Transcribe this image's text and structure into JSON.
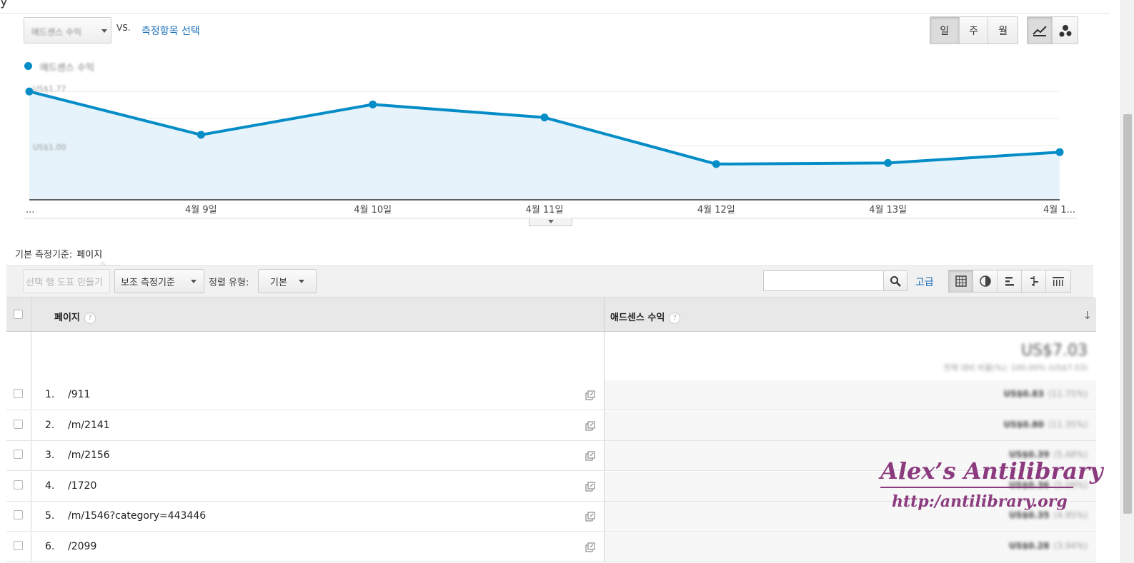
{
  "header": {
    "metric_select": "애드센스 수익",
    "vs": "VS.",
    "choose_metric": "측정항목 선택",
    "period_buttons": [
      "일",
      "주",
      "월"
    ],
    "active_period": "일"
  },
  "legend": {
    "label": "애드센스 수익",
    "color": "#058dc7"
  },
  "chart_data": {
    "type": "area",
    "x": [
      "...",
      "4월 9일",
      "4월 10일",
      "4월 11일",
      "4월 12일",
      "4월 13일",
      "4월 1..."
    ],
    "series": [
      {
        "name": "애드센스 수익",
        "values": [
          100,
          60,
          88,
          76,
          33,
          34,
          44
        ]
      }
    ],
    "y_tick_labels": [
      "US$1.77",
      "US$1.00"
    ],
    "ylim": [
      0,
      110
    ],
    "grid": true,
    "color": "#058dc7"
  },
  "dimension": {
    "label": "기본 측정기준:",
    "value": "페이지"
  },
  "toolbar": {
    "plot_rows": "선택 행 도표 만들기",
    "secondary_dim": "보조 측정기준",
    "sort_label": "정렬 유형:",
    "sort_value": "기본",
    "advanced": "고급"
  },
  "table": {
    "col_page": "페이지",
    "col_metric": "애드센스 수익",
    "help": "?",
    "total_value": "US$7.03",
    "total_sub": "전체 대비 비율(%): 100.00% (US$7.03)",
    "rows": [
      {
        "num": "1.",
        "page": "/911",
        "value": "US$0.83",
        "pct": "(11.75%)"
      },
      {
        "num": "2.",
        "page": "/m/2141",
        "value": "US$0.80",
        "pct": "(11.35%)"
      },
      {
        "num": "3.",
        "page": "/m/2156",
        "value": "US$0.39",
        "pct": "(5.48%)"
      },
      {
        "num": "4.",
        "page": "/1720",
        "value": "US$0.36",
        "pct": "(5.09%)"
      },
      {
        "num": "5.",
        "page": "/m/1546?category=443446",
        "value": "US$0.35",
        "pct": "(4.95%)"
      },
      {
        "num": "6.",
        "page": "/2099",
        "value": "US$0.28",
        "pct": "(3.94%)"
      }
    ]
  },
  "watermark": {
    "title": "Alex’s Antilibrary",
    "url": "http:/antilibrary.org"
  }
}
